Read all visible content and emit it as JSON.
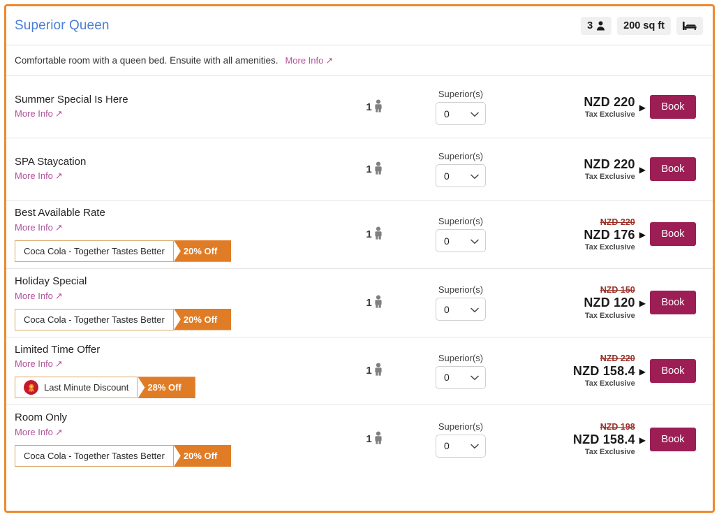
{
  "theme": {
    "frame_border": "#eb8b2e",
    "title_color": "#4a7fd4",
    "link_color": "#b0509a",
    "book_button": "#9c1e55",
    "ribbon": "#e07c26",
    "old_price": "#9b3127"
  },
  "header": {
    "room_title": "Superior Queen",
    "badges": {
      "occupancy_count": "3",
      "occupancy_icon": "person-icon",
      "area": "200 sq ft",
      "bed_icon": "bed-icon"
    }
  },
  "description": {
    "text": "Comfortable room with a queen bed. Ensuite with all amenities.",
    "more_info_label": "More Info",
    "more_info_icon": "arrow-up-right-icon"
  },
  "common": {
    "more_info_label": "More Info",
    "qty_label": "Superior(s)",
    "qty_value": "0",
    "occupancy": "1",
    "occupancy_icon": "person-icon",
    "tax_note": "Tax Exclusive",
    "book_label": "Book",
    "expand_caret": "▶",
    "chevron_down": "⌄"
  },
  "rates": [
    {
      "name": "Summer Special Is Here",
      "more_info_label": "More Info",
      "promo": null,
      "occupancy": "1",
      "qty_label": "Superior(s)",
      "qty_value": "0",
      "price_old": "",
      "price_now": "NZD 220",
      "tax_note": "Tax Exclusive",
      "book_label": "Book"
    },
    {
      "name": "SPA Staycation",
      "more_info_label": "More Info",
      "promo": null,
      "occupancy": "1",
      "qty_label": "Superior(s)",
      "qty_value": "0",
      "price_old": "",
      "price_now": "NZD 220",
      "tax_note": "Tax Exclusive",
      "book_label": "Book"
    },
    {
      "name": "Best Available Rate",
      "more_info_label": "More Info",
      "promo": {
        "icon": null,
        "label": "Coca Cola - Together Tastes Better",
        "ribbon": "20% Off"
      },
      "occupancy": "1",
      "qty_label": "Superior(s)",
      "qty_value": "0",
      "price_old": "NZD 220",
      "price_now": "NZD 176",
      "tax_note": "Tax Exclusive",
      "book_label": "Book"
    },
    {
      "name": "Holiday Special",
      "more_info_label": "More Info",
      "promo": {
        "icon": null,
        "label": "Coca Cola - Together Tastes Better",
        "ribbon": "20% Off"
      },
      "occupancy": "1",
      "qty_label": "Superior(s)",
      "qty_value": "0",
      "price_old": "NZD 150",
      "price_now": "NZD 120",
      "tax_note": "Tax Exclusive",
      "book_label": "Book"
    },
    {
      "name": "Limited Time Offer",
      "more_info_label": "More Info",
      "promo": {
        "icon": "award-ribbon-icon",
        "label": "Last Minute Discount",
        "ribbon": "28% Off"
      },
      "occupancy": "1",
      "qty_label": "Superior(s)",
      "qty_value": "0",
      "price_old": "NZD 220",
      "price_now": "NZD 158.4",
      "tax_note": "Tax Exclusive",
      "book_label": "Book"
    },
    {
      "name": "Room Only",
      "more_info_label": "More Info",
      "promo": {
        "icon": null,
        "label": "Coca Cola - Together Tastes Better",
        "ribbon": "20% Off"
      },
      "occupancy": "1",
      "qty_label": "Superior(s)",
      "qty_value": "0",
      "price_old": "NZD 198",
      "price_now": "NZD 158.4",
      "tax_note": "Tax Exclusive",
      "book_label": "Book"
    }
  ]
}
